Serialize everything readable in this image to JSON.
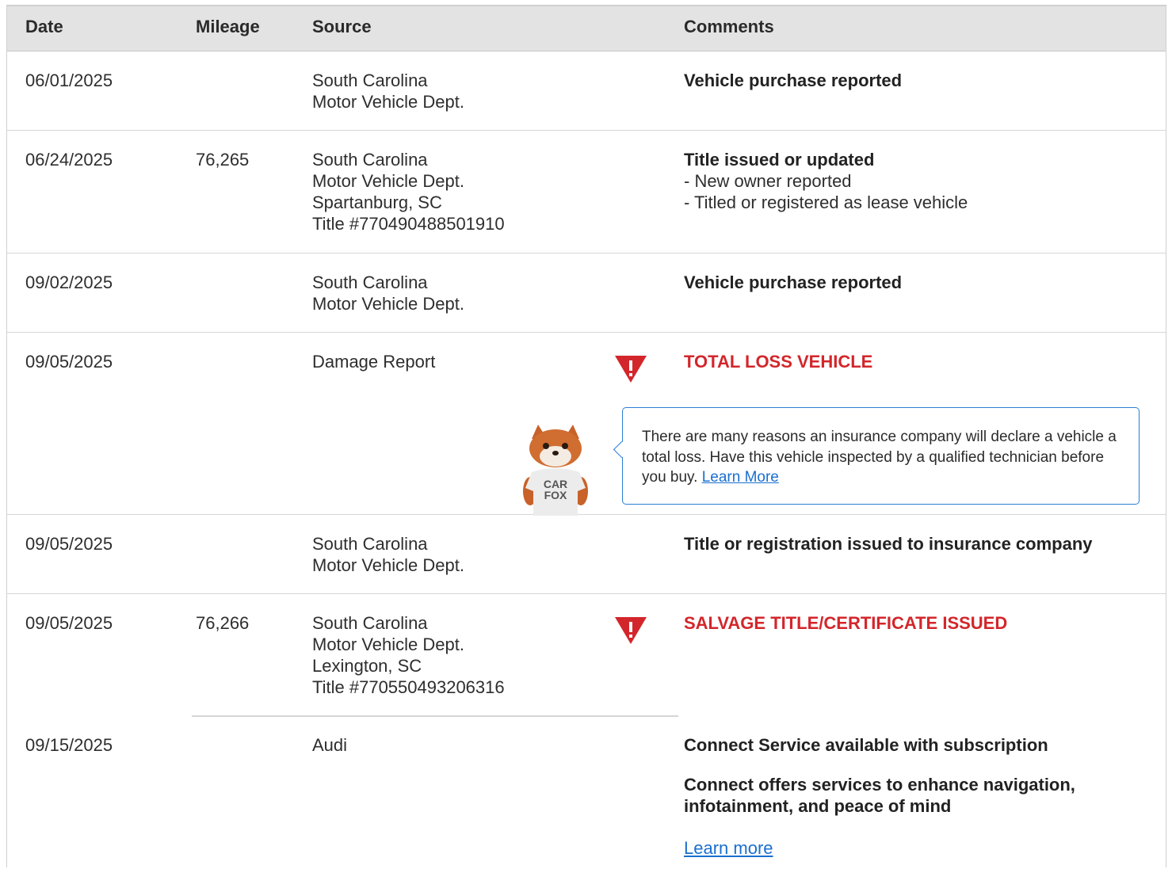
{
  "header": {
    "date": "Date",
    "mileage": "Mileage",
    "source": "Source",
    "comments": "Comments"
  },
  "rows": [
    {
      "date": "06/01/2025",
      "mileage": "",
      "source": [
        "South Carolina",
        "Motor Vehicle Dept."
      ],
      "comment_title": "Vehicle purchase reported",
      "comment_lines": []
    },
    {
      "date": "06/24/2025",
      "mileage": "76,265",
      "source": [
        "South Carolina",
        "Motor Vehicle Dept.",
        "Spartanburg, SC",
        "Title #770490488501910"
      ],
      "comment_title": "Title issued or updated",
      "comment_lines": [
        "- New owner reported",
        "- Titled or registered as lease vehicle"
      ]
    },
    {
      "date": "09/02/2025",
      "mileage": "",
      "source": [
        "South Carolina",
        "Motor Vehicle Dept."
      ],
      "comment_title": "Vehicle purchase reported",
      "comment_lines": []
    },
    {
      "date": "09/05/2025",
      "mileage": "",
      "source": [
        "Damage Report"
      ],
      "alert_title": "TOTAL LOSS VEHICLE",
      "callout_text": "There are many reasons an insurance company will declare a vehicle a total loss. Have this vehicle inspected by a qualified technician before you buy.",
      "callout_link": "Learn More",
      "mascot_shirt": [
        "CAR",
        "FOX"
      ]
    },
    {
      "date": "09/05/2025",
      "mileage": "",
      "source": [
        "South Carolina",
        "Motor Vehicle Dept."
      ],
      "comment_title": "Title or registration issued to insurance company",
      "comment_lines": []
    },
    {
      "date": "09/05/2025",
      "mileage": "76,266",
      "source": [
        "South Carolina",
        "Motor Vehicle Dept.",
        "Lexington, SC",
        "Title #770550493206316"
      ],
      "alert_title": "SALVAGE TITLE/CERTIFICATE ISSUED"
    },
    {
      "date": "09/15/2025",
      "mileage": "",
      "source": [
        "Audi"
      ],
      "comment_title": "Connect Service available with subscription",
      "comment_para": [
        "Connect offers services to enhance navigation,",
        "infotainment, and peace of mind"
      ],
      "link": "Learn more"
    }
  ],
  "icons": {
    "warning": "warning-triangle-icon",
    "mascot": "carfox-mascot"
  },
  "colors": {
    "alert_red": "#d3262b",
    "link_blue": "#1a6fcf",
    "header_bg": "#e3e3e3",
    "callout_border": "#2b7fd4"
  }
}
